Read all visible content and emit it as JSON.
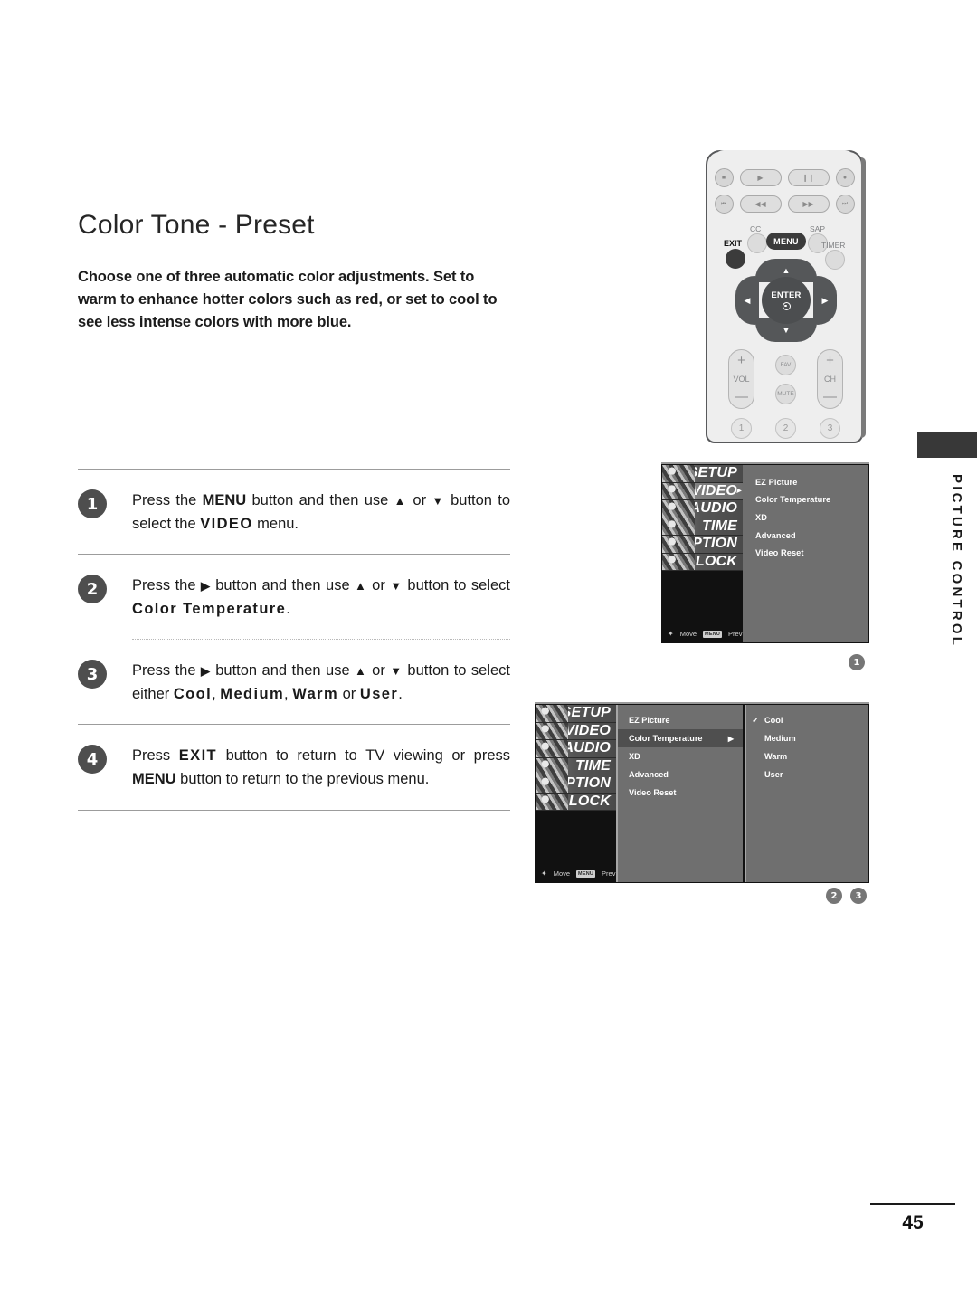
{
  "document": {
    "title": "Color Tone - Preset",
    "intro": "Choose one of three automatic color adjustments. Set to warm to enhance hotter colors such as red, or set to cool to see less intense colors with more blue.",
    "page_number": "45",
    "side_tab_label": "PICTURE CONTROL"
  },
  "steps": [
    {
      "number": "1",
      "pre": "Press the ",
      "b1": "MENU",
      "mid": " button and then use ",
      "up": "▲",
      "or": " or ",
      "down": "▼",
      "post": " button to select the ",
      "b2": "VIDEO",
      "end": " menu."
    },
    {
      "number": "2",
      "pre": "Press the ",
      "b1": "▶",
      "mid": " button and then use ",
      "up": "▲",
      "or": " or ",
      "down": "▼",
      "post": " button to select ",
      "b2": "Color Temperature",
      "end": "."
    },
    {
      "number": "3",
      "pre": "Press the ",
      "b1": "▶",
      "mid": " button and then use ",
      "up": "▲",
      "or": " or ",
      "down": "▼",
      "post": " button to select either ",
      "b2": "Cool",
      "sep1": ", ",
      "b3": "Medium",
      "sep2": ", ",
      "b4": "Warm",
      "sep3": " or ",
      "b5": "User",
      "end": "."
    },
    {
      "number": "4",
      "pre": "Press ",
      "b1": "EXIT",
      "mid": " button to return to TV viewing or press ",
      "b2": "MENU",
      "end": " button to return to the previous menu."
    }
  ],
  "remote": {
    "transport_row1": [
      "stop-icon",
      "play-icon",
      "pause-icon",
      "record-icon"
    ],
    "transport_row2": [
      "skip-back-icon",
      "rewind-icon",
      "fast-forward-icon",
      "skip-forward-icon"
    ],
    "transport_glyphs": {
      "stop": "■",
      "play": "▶",
      "pause": "❙❙",
      "record": "●",
      "skip_back": "⏮",
      "rewind": "◀◀",
      "forward": "▶▶",
      "skip_forward": "⏭"
    },
    "cc_label": "CC",
    "menu_label": "MENU",
    "sap_label": "SAP",
    "exit_label": "EXIT",
    "timer_label": "TIMER",
    "enter_label": "ENTER",
    "dpad": {
      "up": "▲",
      "down": "▼",
      "left": "◀",
      "right": "▶"
    },
    "vol_label": "VOL",
    "ch_label": "CH",
    "plus": "+",
    "minus": "—",
    "fav_label": "FAV",
    "mute_label": "MUTE",
    "numbers": [
      "1",
      "2",
      "3"
    ]
  },
  "osd1": {
    "sidebar": [
      {
        "label": "SETUP",
        "active": false
      },
      {
        "label": "VIDEO",
        "active": true
      },
      {
        "label": "AUDIO",
        "active": false
      },
      {
        "label": "TIME",
        "active": false
      },
      {
        "label": "OPTION",
        "active": false
      },
      {
        "label": "LOCK",
        "active": false
      }
    ],
    "items": [
      "EZ Picture",
      "Color Temperature",
      "XD",
      "Advanced",
      "Video Reset"
    ],
    "hint_move": "Move",
    "hint_prev": "Prev",
    "hint_prev_badge": "MENU",
    "marker": "1"
  },
  "osd2": {
    "sidebar": [
      {
        "label": "SETUP",
        "active": false
      },
      {
        "label": "VIDEO",
        "active": false
      },
      {
        "label": "AUDIO",
        "active": false
      },
      {
        "label": "TIME",
        "active": false
      },
      {
        "label": "OPTION",
        "active": false
      },
      {
        "label": "LOCK",
        "active": false
      }
    ],
    "items": [
      {
        "label": "EZ Picture",
        "selected": false,
        "caret": ""
      },
      {
        "label": "Color Temperature",
        "selected": true,
        "caret": "▶"
      },
      {
        "label": "XD",
        "selected": false,
        "caret": ""
      },
      {
        "label": "Advanced",
        "selected": false,
        "caret": ""
      },
      {
        "label": "Video Reset",
        "selected": false,
        "caret": ""
      }
    ],
    "options": [
      {
        "label": "Cool",
        "check": "✓"
      },
      {
        "label": "Medium",
        "check": ""
      },
      {
        "label": "Warm",
        "check": ""
      },
      {
        "label": "User",
        "check": ""
      }
    ],
    "hint_move": "Move",
    "hint_prev": "Prev",
    "hint_prev_badge": "MENU",
    "markers": [
      "2",
      "3"
    ]
  },
  "colors": {
    "text": "#1a1a1a",
    "rule": "#9c9c9c",
    "badge": "#4e4e4e",
    "osd_panel": "#6f6f6f",
    "osd_selected": "#4f4f4f",
    "osd_black": "#111111",
    "side_tab": "#383838",
    "marker": "#767676"
  }
}
